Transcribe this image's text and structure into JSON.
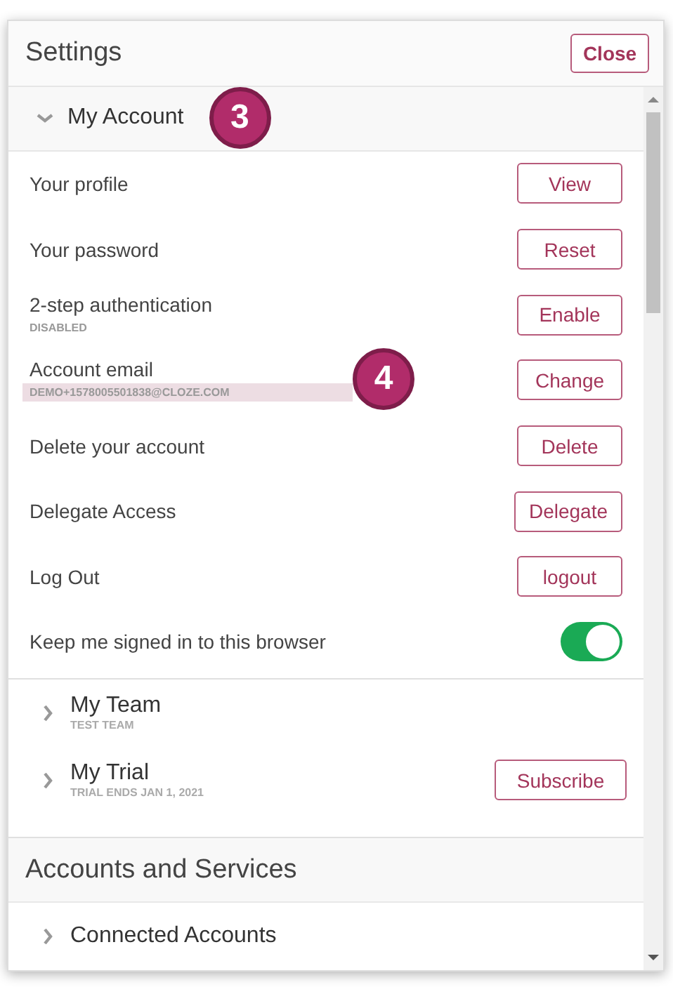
{
  "window": {
    "title": "Settings",
    "close_button": "Close"
  },
  "account": {
    "title": "My Account",
    "expanded": true,
    "callout": "3",
    "rows": [
      {
        "kind": "button",
        "label": "Your profile",
        "button": "View"
      },
      {
        "kind": "button",
        "label": "Your password",
        "button": "Reset"
      },
      {
        "kind": "button",
        "label": "2-step authentication",
        "sublabel": "DISABLED",
        "button": "Enable"
      },
      {
        "kind": "button",
        "label": "Account email",
        "sublabel": "DEMO+1578005501838@CLOZE.COM",
        "highlighted": true,
        "callout": "4",
        "button": "Change"
      },
      {
        "kind": "button",
        "label": "Delete your account",
        "button": "Delete"
      },
      {
        "kind": "button",
        "label": "Delegate Access",
        "button": "Delegate"
      },
      {
        "kind": "button",
        "label": "Log Out",
        "button": "logout"
      },
      {
        "kind": "toggle",
        "label": "Keep me signed in to this browser",
        "on": true
      }
    ]
  },
  "groups": [
    {
      "title": "My Team",
      "sublabel": "TEST TEAM",
      "expanded": false
    },
    {
      "title": "My Trial",
      "sublabel": "TRIAL ENDS JAN 1, 2021",
      "expanded": false,
      "button": "Subscribe"
    }
  ],
  "accounts_services": {
    "title": "Accounts and Services",
    "items": [
      {
        "title": "Connected Accounts",
        "expanded": false
      }
    ]
  }
}
